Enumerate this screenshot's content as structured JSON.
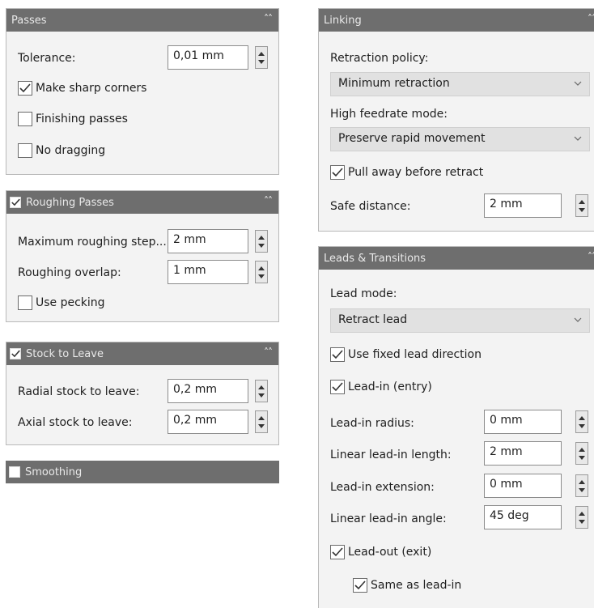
{
  "passes": {
    "title": "Passes",
    "tolerance_label": "Tolerance:",
    "tolerance_value": "0,01 mm",
    "make_sharp_corners": {
      "label": "Make sharp corners",
      "checked": true
    },
    "finishing_passes": {
      "label": "Finishing passes",
      "checked": false
    },
    "no_dragging": {
      "label": "No dragging",
      "checked": false
    }
  },
  "roughing": {
    "title": "Roughing Passes",
    "enabled": true,
    "max_step_label": "Maximum roughing step...",
    "max_step_value": "2 mm",
    "overlap_label": "Roughing overlap:",
    "overlap_value": "1 mm",
    "use_pecking": {
      "label": "Use pecking",
      "checked": false
    }
  },
  "stock": {
    "title": "Stock to Leave",
    "enabled": true,
    "radial_label": "Radial stock to leave:",
    "radial_value": "0,2 mm",
    "axial_label": "Axial stock to leave:",
    "axial_value": "0,2 mm"
  },
  "smoothing": {
    "title": "Smoothing",
    "enabled": false
  },
  "linking": {
    "title": "Linking",
    "retraction_policy_label": "Retraction policy:",
    "retraction_policy_value": "Minimum retraction",
    "high_feedrate_label": "High feedrate mode:",
    "high_feedrate_value": "Preserve rapid movement",
    "pull_away": {
      "label": "Pull away before retract",
      "checked": true
    },
    "safe_distance_label": "Safe distance:",
    "safe_distance_value": "2 mm"
  },
  "leads": {
    "title": "Leads & Transitions",
    "lead_mode_label": "Lead mode:",
    "lead_mode_value": "Retract lead",
    "use_fixed_direction": {
      "label": "Use fixed lead direction",
      "checked": true
    },
    "lead_in": {
      "label": "Lead-in (entry)",
      "checked": true
    },
    "lead_in_radius_label": "Lead-in radius:",
    "lead_in_radius_value": "0 mm",
    "linear_lead_in_length_label": "Linear lead-in length:",
    "linear_lead_in_length_value": "2 mm",
    "lead_in_extension_label": "Lead-in extension:",
    "lead_in_extension_value": "0 mm",
    "linear_lead_in_angle_label": "Linear lead-in angle:",
    "linear_lead_in_angle_value": "45 deg",
    "lead_out": {
      "label": "Lead-out (exit)",
      "checked": true
    },
    "same_as_lead_in": {
      "label": "Same as lead-in",
      "checked": true
    }
  },
  "icons": {
    "check": "checkmark-icon",
    "collapse": "double-chevron-up-icon",
    "dropdown": "chevron-down-icon",
    "spin": "spin-arrows-icon"
  },
  "colors": {
    "header_bg": "#6e6e6e",
    "panel_bg": "#f3f3f3",
    "dropdown_bg": "#e1e1e1"
  }
}
